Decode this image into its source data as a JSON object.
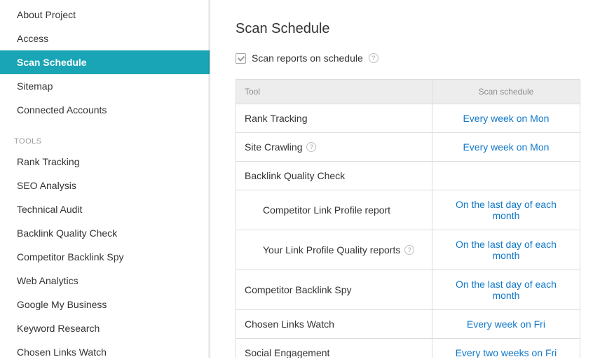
{
  "sidebar": {
    "settings": [
      {
        "label": "About Project",
        "active": false
      },
      {
        "label": "Access",
        "active": false
      },
      {
        "label": "Scan Schedule",
        "active": true
      },
      {
        "label": "Sitemap",
        "active": false
      },
      {
        "label": "Connected Accounts",
        "active": false
      }
    ],
    "tools_header": "TOOLS",
    "tools": [
      {
        "label": "Rank Tracking"
      },
      {
        "label": "SEO Analysis"
      },
      {
        "label": "Technical Audit"
      },
      {
        "label": "Backlink Quality Check"
      },
      {
        "label": "Competitor Backlink Spy"
      },
      {
        "label": "Web Analytics"
      },
      {
        "label": "Google My Business"
      },
      {
        "label": "Keyword Research"
      },
      {
        "label": "Chosen Links Watch"
      }
    ]
  },
  "main": {
    "title": "Scan Schedule",
    "checkbox_label": "Scan reports on schedule",
    "checkbox_checked": true,
    "table": {
      "headers": {
        "tool": "Tool",
        "schedule": "Scan schedule"
      },
      "rows": [
        {
          "tool": "Rank Tracking",
          "schedule": "Every week on Mon",
          "indent": false,
          "help": false
        },
        {
          "tool": "Site Crawling",
          "schedule": "Every week on Mon",
          "indent": false,
          "help": true
        },
        {
          "tool": "Backlink Quality Check",
          "schedule": "",
          "indent": false,
          "help": false
        },
        {
          "tool": "Competitor Link Profile report",
          "schedule": "On the last day of each month",
          "indent": true,
          "help": false
        },
        {
          "tool": "Your Link Profile Quality reports",
          "schedule": "On the last day of each month",
          "indent": true,
          "help": true
        },
        {
          "tool": "Competitor Backlink Spy",
          "schedule": "On the last day of each month",
          "indent": false,
          "help": false
        },
        {
          "tool": "Chosen Links Watch",
          "schedule": "Every week on Fri",
          "indent": false,
          "help": false
        },
        {
          "tool": "Social Engagement",
          "schedule": "Every two weeks on Fri",
          "indent": false,
          "help": false
        }
      ]
    }
  }
}
